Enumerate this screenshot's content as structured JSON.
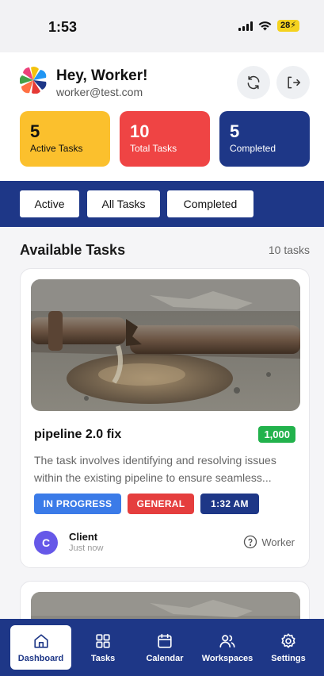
{
  "status_bar": {
    "time": "1:53",
    "battery": "28"
  },
  "header": {
    "greeting": "Hey, Worker!",
    "email": "worker@test.com",
    "refresh_icon": "refresh-icon",
    "logout_icon": "logout-icon"
  },
  "stats": [
    {
      "value": "5",
      "label": "Active Tasks",
      "color": "#fbc02d"
    },
    {
      "value": "10",
      "label": "Total Tasks",
      "color": "#ef4444"
    },
    {
      "value": "5",
      "label": "Completed",
      "color": "#1e3787"
    }
  ],
  "filters": [
    "Active",
    "All Tasks",
    "Completed"
  ],
  "section": {
    "title": "Available Tasks",
    "count": "10 tasks"
  },
  "task": {
    "title": "pipeline 2.0 fix",
    "price": "1,000",
    "description": "The task involves identifying and resolving issues within the existing pipeline to ensure seamless...",
    "tags": [
      {
        "label": "IN PROGRESS",
        "color": "#3b7be8"
      },
      {
        "label": "GENERAL",
        "color": "#e53e3e"
      },
      {
        "label": "1:32 AM",
        "color": "#1e3787"
      }
    ],
    "client": {
      "initial": "C",
      "name": "Client",
      "time": "Just now"
    },
    "role": "Worker"
  },
  "nav": [
    {
      "label": "Dashboard",
      "icon": "home-icon",
      "active": true
    },
    {
      "label": "Tasks",
      "icon": "grid-icon",
      "active": false
    },
    {
      "label": "Calendar",
      "icon": "calendar-icon",
      "active": false
    },
    {
      "label": "Workspaces",
      "icon": "users-icon",
      "active": false
    },
    {
      "label": "Settings",
      "icon": "gear-icon",
      "active": false
    }
  ],
  "colors": {
    "primary": "#1e3787",
    "price_green": "#22b24c",
    "avatar": "#6658e8"
  }
}
